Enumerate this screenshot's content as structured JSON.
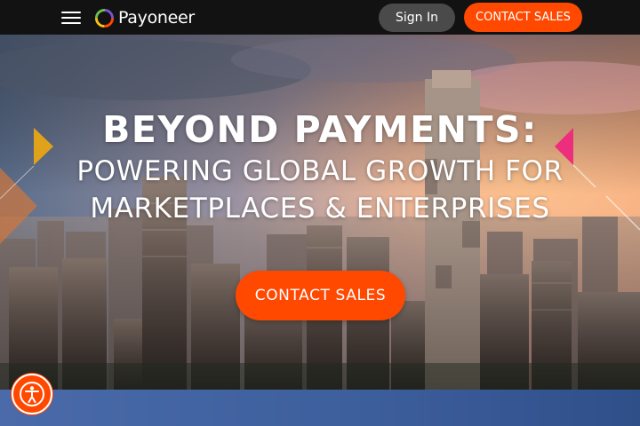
{
  "header": {
    "menu_icon": "hamburger-menu-icon",
    "logo_text": "Payoneer",
    "sign_in_label": "Sign In",
    "contact_sales_label": "CONTACT SALES"
  },
  "hero": {
    "title": "BEYOND PAYMENTS:",
    "subtitle_line1": "POWERING GLOBAL GROWTH FOR",
    "subtitle_line2": "MARKETPLACES & ENTERPRISES",
    "cta_label": "CONTACT SALES"
  },
  "accessibility": {
    "icon": "accessibility-person-icon"
  },
  "colors": {
    "accent": "#ff4800",
    "topbar": "#121212",
    "signin_bg": "#4a4a4a",
    "bottom_band": "#3d5f9c",
    "triangle_gold": "#e0a21a",
    "triangle_pink": "#ec2e7c"
  }
}
